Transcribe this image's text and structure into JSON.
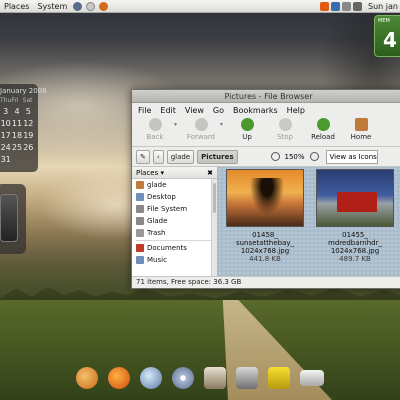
{
  "top_panel": {
    "menu_places": "Places",
    "menu_system": "System",
    "clock": "Sun jan"
  },
  "calendar": {
    "title": "January 2008",
    "day_headers": [
      "Thu",
      "Fri",
      "Sat"
    ],
    "days": [
      "",
      "",
      "",
      "3",
      "4",
      "5",
      "10",
      "11",
      "12",
      "17",
      "18",
      "19",
      "24",
      "25",
      "26",
      "31",
      "",
      ""
    ]
  },
  "memory_widget": {
    "label": "MEM",
    "value": "4"
  },
  "window": {
    "title": "Pictures - File Browser",
    "menu": [
      "File",
      "Edit",
      "View",
      "Go",
      "Bookmarks",
      "Help"
    ],
    "toolbar": {
      "back": "Back",
      "forward": "Forward",
      "up": "Up",
      "stop": "Stop",
      "reload": "Reload",
      "home": "Home"
    },
    "location": {
      "parent": "glade",
      "current": "Pictures",
      "zoom": "150%",
      "view_mode": "View as Icons"
    },
    "sidebar": {
      "header": "Places",
      "items": [
        "glade",
        "Desktop",
        "File System",
        "Glade",
        "Trash",
        "Documents",
        "Music"
      ]
    },
    "files": [
      {
        "name_line1": "01458_",
        "name_line2": "sunsetatthebay_",
        "name_line3": "1024x768.jpg",
        "size": "441.8 KB"
      },
      {
        "name_line1": "01455_",
        "name_line2": "mdredbarnhdr_",
        "name_line3": "1024x768.jpg",
        "size": "489.7 KB"
      }
    ],
    "status": "71 items, Free space: 36.3 GB"
  },
  "colors": {
    "accent_green": "#4a9a2e",
    "mem_green": "#3f7a2c",
    "folder_blue": "#6f8fb8"
  }
}
